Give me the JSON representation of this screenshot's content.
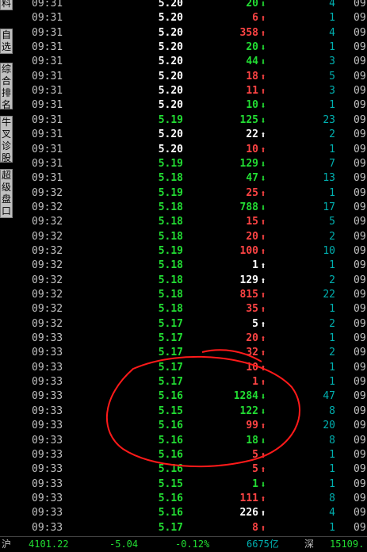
{
  "colors": {
    "up": "#ff4444",
    "down": "#22dd33",
    "flat": "#ffffff",
    "time": "#c0c0c0",
    "count": "#00b0b0"
  },
  "sidebar": {
    "tabs": [
      {
        "label": "料"
      },
      {
        "label": "自\n选\n股"
      },
      {
        "label": "综\n合\n排\n名"
      },
      {
        "label": "牛\n叉\n诊\n股"
      },
      {
        "label": "超\n级\n盘\n口"
      }
    ]
  },
  "ticks": [
    {
      "time": "09:31",
      "price": "5.20",
      "vol": "20",
      "dir": "down",
      "count": "4",
      "next": "09"
    },
    {
      "time": "09:31",
      "price": "5.20",
      "vol": "6",
      "dir": "up",
      "count": "1",
      "next": "09"
    },
    {
      "time": "09:31",
      "price": "5.20",
      "vol": "358",
      "dir": "up",
      "count": "4",
      "next": "09"
    },
    {
      "time": "09:31",
      "price": "5.20",
      "vol": "20",
      "dir": "down",
      "count": "1",
      "next": "09"
    },
    {
      "time": "09:31",
      "price": "5.20",
      "vol": "44",
      "dir": "down",
      "count": "3",
      "next": "09"
    },
    {
      "time": "09:31",
      "price": "5.20",
      "vol": "18",
      "dir": "up",
      "count": "5",
      "next": "09"
    },
    {
      "time": "09:31",
      "price": "5.20",
      "vol": "11",
      "dir": "up",
      "count": "3",
      "next": "09"
    },
    {
      "time": "09:31",
      "price": "5.20",
      "vol": "10",
      "dir": "down",
      "count": "1",
      "next": "09"
    },
    {
      "time": "09:31",
      "price": "5.19",
      "vol": "125",
      "dir": "down",
      "count": "23",
      "next": "09"
    },
    {
      "time": "09:31",
      "price": "5.20",
      "vol": "22",
      "dir": "flat",
      "count": "2",
      "next": "09"
    },
    {
      "time": "09:31",
      "price": "5.20",
      "vol": "10",
      "dir": "up",
      "count": "1",
      "next": "09"
    },
    {
      "time": "09:31",
      "price": "5.19",
      "vol": "129",
      "dir": "down",
      "count": "7",
      "next": "09"
    },
    {
      "time": "09:31",
      "price": "5.18",
      "vol": "47",
      "dir": "down",
      "count": "13",
      "next": "09"
    },
    {
      "time": "09:32",
      "price": "5.19",
      "vol": "25",
      "dir": "up",
      "count": "1",
      "next": "09"
    },
    {
      "time": "09:32",
      "price": "5.18",
      "vol": "788",
      "dir": "down",
      "count": "17",
      "next": "09"
    },
    {
      "time": "09:32",
      "price": "5.18",
      "vol": "15",
      "dir": "up",
      "count": "5",
      "next": "09"
    },
    {
      "time": "09:32",
      "price": "5.18",
      "vol": "20",
      "dir": "up",
      "count": "2",
      "next": "09"
    },
    {
      "time": "09:32",
      "price": "5.19",
      "vol": "100",
      "dir": "up",
      "count": "10",
      "next": "09"
    },
    {
      "time": "09:32",
      "price": "5.18",
      "vol": "1",
      "dir": "flat",
      "count": "1",
      "next": "09"
    },
    {
      "time": "09:32",
      "price": "5.18",
      "vol": "129",
      "dir": "flat",
      "count": "2",
      "next": "09"
    },
    {
      "time": "09:32",
      "price": "5.18",
      "vol": "815",
      "dir": "up",
      "count": "22",
      "next": "09"
    },
    {
      "time": "09:32",
      "price": "5.18",
      "vol": "35",
      "dir": "up",
      "count": "1",
      "next": "09"
    },
    {
      "time": "09:32",
      "price": "5.17",
      "vol": "5",
      "dir": "flat",
      "count": "2",
      "next": "09"
    },
    {
      "time": "09:33",
      "price": "5.17",
      "vol": "20",
      "dir": "up",
      "count": "1",
      "next": "09"
    },
    {
      "time": "09:33",
      "price": "5.17",
      "vol": "32",
      "dir": "up",
      "count": "2",
      "next": "09"
    },
    {
      "time": "09:33",
      "price": "5.17",
      "vol": "10",
      "dir": "up",
      "count": "1",
      "next": "09"
    },
    {
      "time": "09:33",
      "price": "5.17",
      "vol": "1",
      "dir": "up",
      "count": "1",
      "next": "09"
    },
    {
      "time": "09:33",
      "price": "5.16",
      "vol": "1284",
      "dir": "down",
      "count": "47",
      "next": "09"
    },
    {
      "time": "09:33",
      "price": "5.15",
      "vol": "122",
      "dir": "down",
      "count": "8",
      "next": "09"
    },
    {
      "time": "09:33",
      "price": "5.16",
      "vol": "99",
      "dir": "up",
      "count": "20",
      "next": "09"
    },
    {
      "time": "09:33",
      "price": "5.16",
      "vol": "18",
      "dir": "down",
      "count": "8",
      "next": "09"
    },
    {
      "time": "09:33",
      "price": "5.16",
      "vol": "5",
      "dir": "up",
      "count": "1",
      "next": "09"
    },
    {
      "time": "09:33",
      "price": "5.16",
      "vol": "5",
      "dir": "up",
      "count": "1",
      "next": "09"
    },
    {
      "time": "09:33",
      "price": "5.15",
      "vol": "1",
      "dir": "down",
      "count": "1",
      "next": "09"
    },
    {
      "time": "09:33",
      "price": "5.16",
      "vol": "111",
      "dir": "up",
      "count": "8",
      "next": "09"
    },
    {
      "time": "09:33",
      "price": "5.16",
      "vol": "226",
      "dir": "flat",
      "count": "4",
      "next": "09"
    },
    {
      "time": "09:33",
      "price": "5.17",
      "vol": "8",
      "dir": "up",
      "count": "1",
      "next": "09"
    }
  ],
  "footer": {
    "index_label": "沪",
    "index_value": "4101.22",
    "change": "-5.04",
    "change_pct": "-0.12%",
    "amount": "6675亿",
    "sz_label": "深",
    "sz_value": "15109."
  }
}
